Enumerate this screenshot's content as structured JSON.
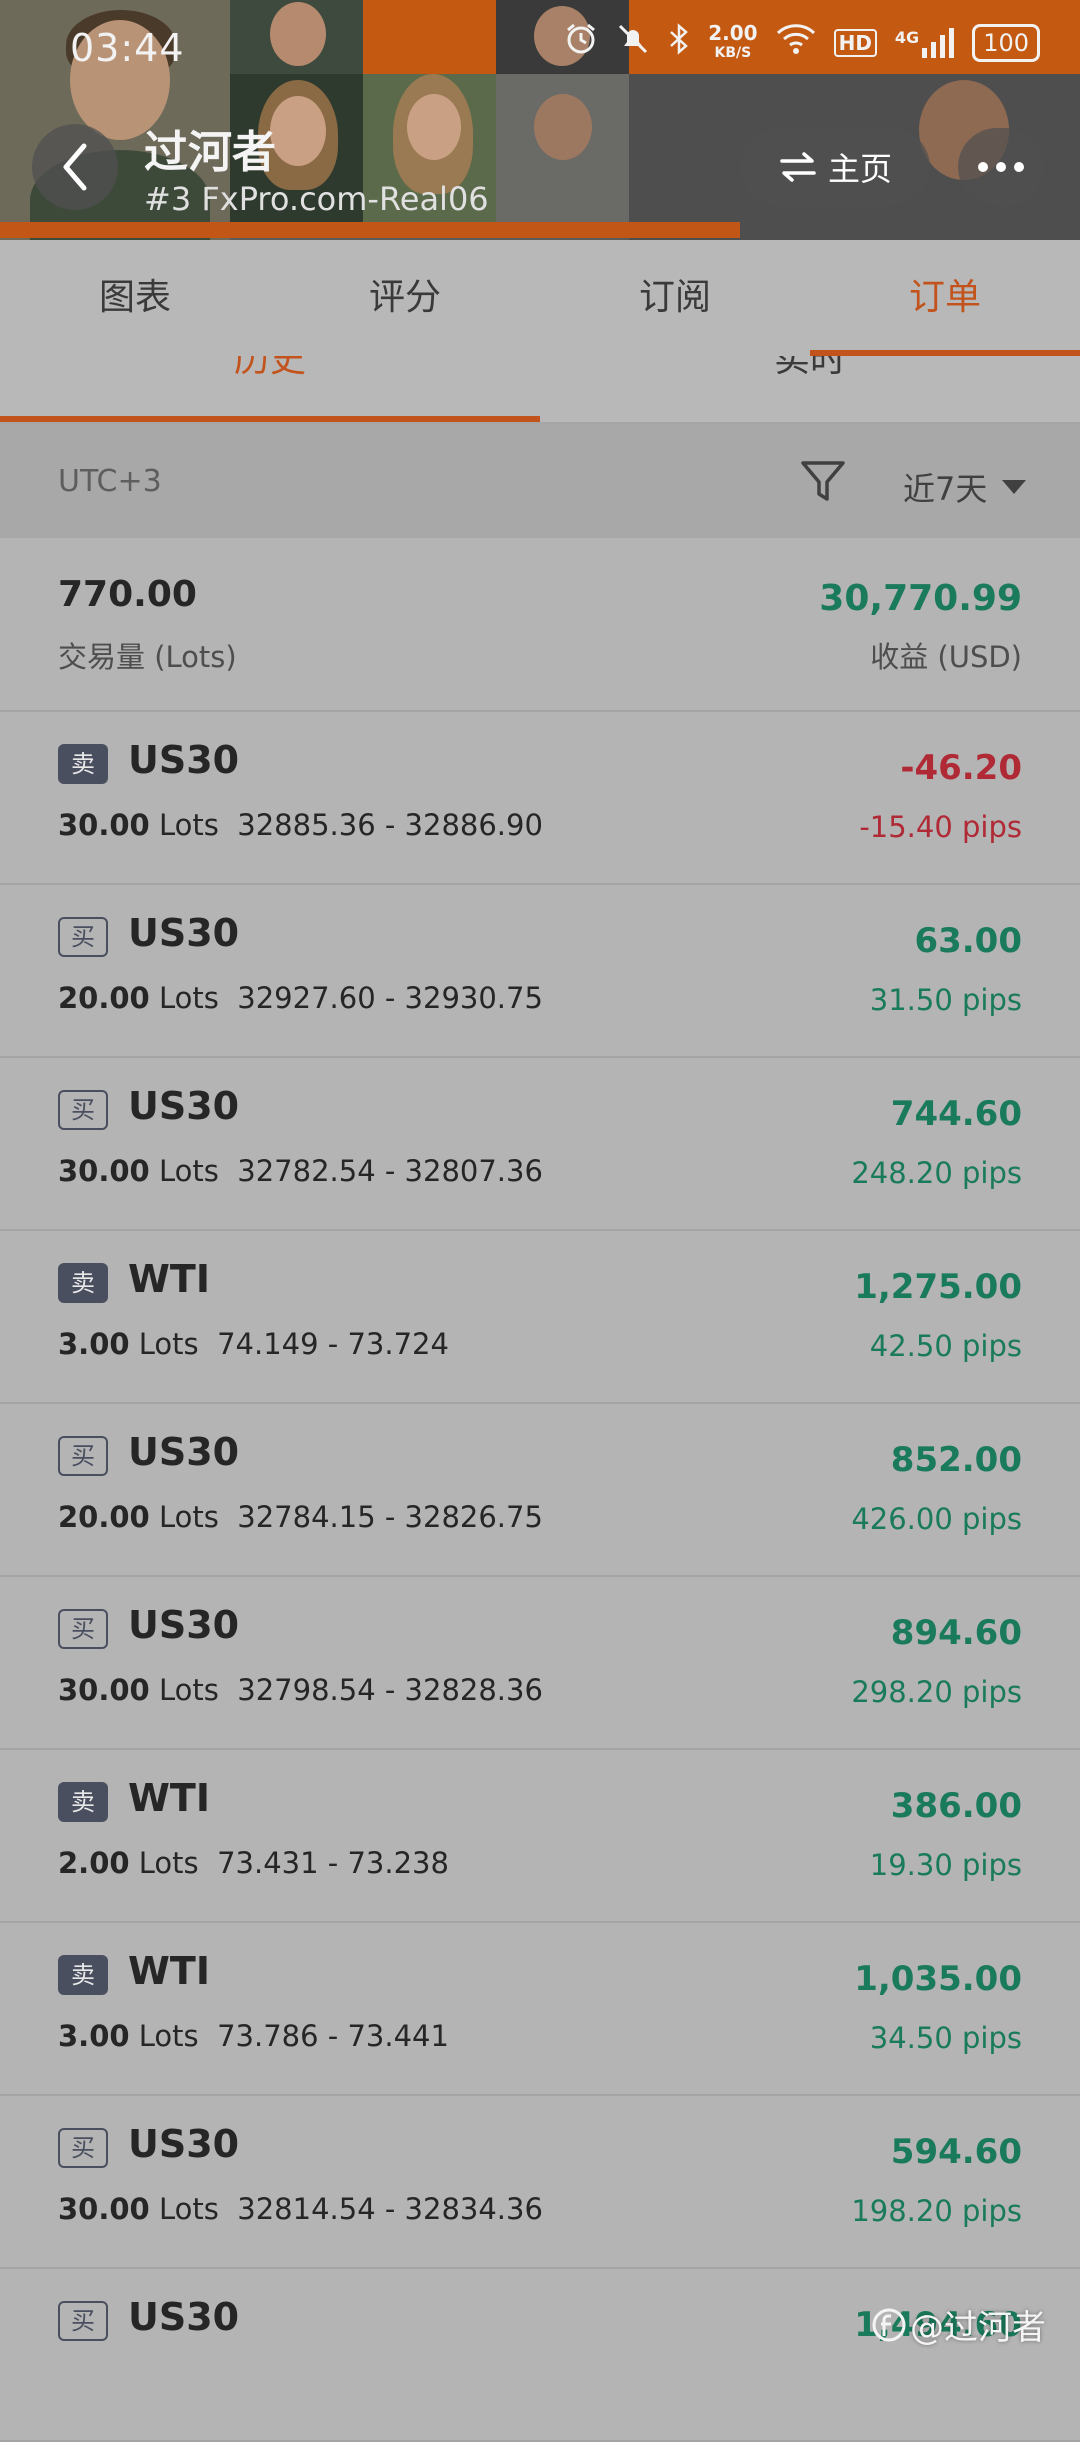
{
  "status_bar": {
    "time": "03:44",
    "speed_value": "2.00",
    "speed_unit": "KB/S",
    "network": "4G",
    "battery": "100"
  },
  "header": {
    "nickname": "过河者",
    "subtitle": "#3 FxPro.com-Real06",
    "home_label": "主页"
  },
  "main_tabs": [
    {
      "label": "图表"
    },
    {
      "label": "评分"
    },
    {
      "label": "订阅"
    },
    {
      "label": "订单"
    }
  ],
  "sub_tabs": [
    {
      "label": "历史"
    },
    {
      "label": "实时"
    }
  ],
  "filter": {
    "timezone": "UTC+3",
    "period": "近7天"
  },
  "summary": {
    "volume": "770.00",
    "volume_label": "交易量 (Lots)",
    "profit": "30,770.99",
    "profit_label": "收益 (USD)"
  },
  "orders": [
    {
      "side": "卖",
      "symbol": "US30",
      "lots": "30.00",
      "lots_unit": "Lots",
      "range": "32885.36 - 32886.90",
      "profit": "-46.20",
      "pips": "-15.40 pips"
    },
    {
      "side": "买",
      "symbol": "US30",
      "lots": "20.00",
      "lots_unit": "Lots",
      "range": "32927.60 - 32930.75",
      "profit": "63.00",
      "pips": "31.50 pips"
    },
    {
      "side": "买",
      "symbol": "US30",
      "lots": "30.00",
      "lots_unit": "Lots",
      "range": "32782.54 - 32807.36",
      "profit": "744.60",
      "pips": "248.20 pips"
    },
    {
      "side": "卖",
      "symbol": "WTI",
      "lots": "3.00",
      "lots_unit": "Lots",
      "range": "74.149 - 73.724",
      "profit": "1,275.00",
      "pips": "42.50 pips"
    },
    {
      "side": "买",
      "symbol": "US30",
      "lots": "20.00",
      "lots_unit": "Lots",
      "range": "32784.15 - 32826.75",
      "profit": "852.00",
      "pips": "426.00 pips"
    },
    {
      "side": "买",
      "symbol": "US30",
      "lots": "30.00",
      "lots_unit": "Lots",
      "range": "32798.54 - 32828.36",
      "profit": "894.60",
      "pips": "298.20 pips"
    },
    {
      "side": "卖",
      "symbol": "WTI",
      "lots": "2.00",
      "lots_unit": "Lots",
      "range": "73.431 - 73.238",
      "profit": "386.00",
      "pips": "19.30 pips"
    },
    {
      "side": "卖",
      "symbol": "WTI",
      "lots": "3.00",
      "lots_unit": "Lots",
      "range": "73.786 - 73.441",
      "profit": "1,035.00",
      "pips": "34.50 pips"
    },
    {
      "side": "买",
      "symbol": "US30",
      "lots": "30.00",
      "lots_unit": "Lots",
      "range": "32814.54 - 32834.36",
      "profit": "594.60",
      "pips": "198.20 pips"
    },
    {
      "side": "买",
      "symbol": "US30",
      "lots": "",
      "lots_unit": "",
      "range": "",
      "profit": "1,494.60",
      "pips": ""
    }
  ],
  "watermark": "@过河者",
  "colors": {
    "accent": "#c2531c",
    "profit_positive": "#1a7a5c",
    "profit_negative": "#b02a36",
    "sell_badge": "#4a4f60"
  }
}
